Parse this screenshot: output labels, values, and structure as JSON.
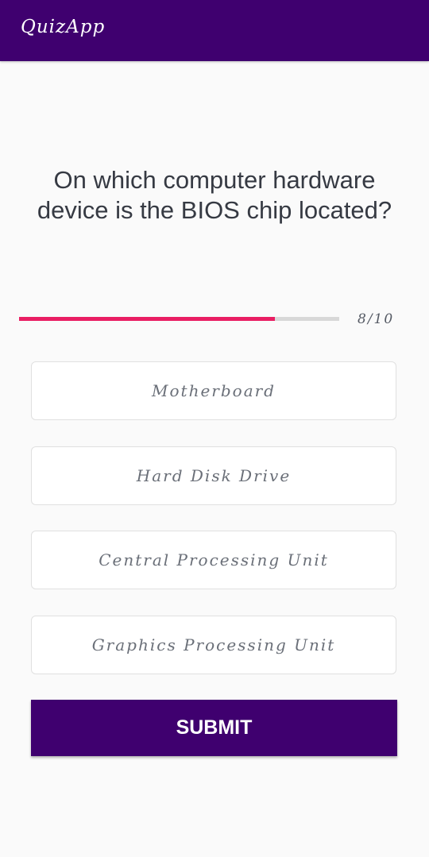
{
  "app": {
    "title": "QuizApp",
    "brand_color": "#3f006f"
  },
  "question": {
    "text": "On which computer hardware device is the BIOS chip located?"
  },
  "progress": {
    "current": 8,
    "total": 10,
    "label": "8/10",
    "fill_color": "#e91e63"
  },
  "options": [
    {
      "label": "Motherboard"
    },
    {
      "label": "Hard Disk Drive"
    },
    {
      "label": "Central Processing Unit"
    },
    {
      "label": "Graphics Processing Unit"
    }
  ],
  "submit": {
    "label": "SUBMIT"
  }
}
